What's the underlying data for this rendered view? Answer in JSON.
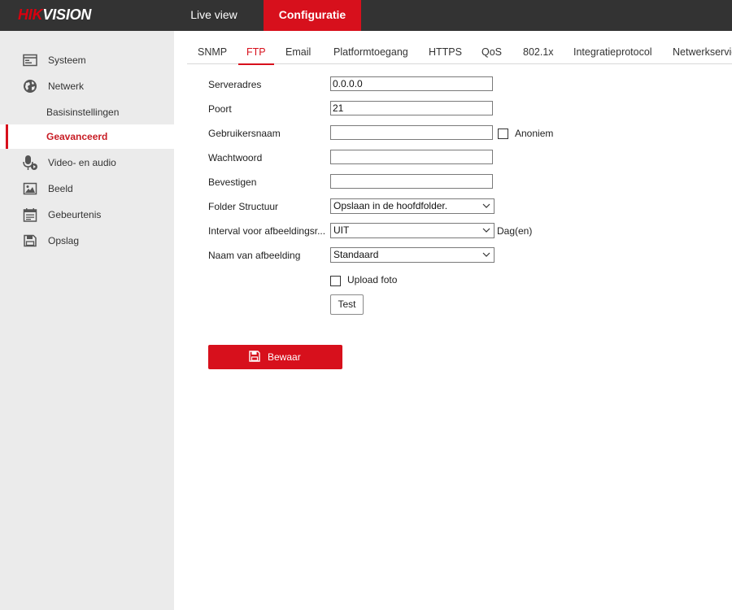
{
  "brand": {
    "name": "HIKVISION",
    "accent_color": "#d7101c",
    "topbar_color": "#333333"
  },
  "topnav": {
    "live_view": "Live view",
    "configuration": "Configuratie"
  },
  "sidebar": {
    "items": [
      {
        "label": "Systeem",
        "icon": "system-icon"
      },
      {
        "label": "Netwerk",
        "icon": "globe-icon"
      },
      {
        "label": "Basisinstellingen"
      },
      {
        "label": "Geavanceerd",
        "active": true
      },
      {
        "label": "Video- en audio",
        "icon": "microphone-icon"
      },
      {
        "label": "Beeld",
        "icon": "image-icon"
      },
      {
        "label": "Gebeurtenis",
        "icon": "calendar-icon"
      },
      {
        "label": "Opslag",
        "icon": "storage-icon"
      }
    ]
  },
  "tabs": [
    {
      "label": "SNMP"
    },
    {
      "label": "FTP",
      "active": true
    },
    {
      "label": "Email"
    },
    {
      "label": "Platformtoegang"
    },
    {
      "label": "HTTPS"
    },
    {
      "label": "QoS"
    },
    {
      "label": "802.1x"
    },
    {
      "label": "Integratieprotocol"
    },
    {
      "label": "Netwerkservice"
    }
  ],
  "form": {
    "server_address": {
      "label": "Serveradres",
      "value": "0.0.0.0"
    },
    "port": {
      "label": "Poort",
      "value": "21"
    },
    "username": {
      "label": "Gebruikersnaam",
      "value": ""
    },
    "anonymous": {
      "label": "Anoniem",
      "checked": false
    },
    "password": {
      "label": "Wachtwoord",
      "value": ""
    },
    "confirm": {
      "label": "Bevestigen",
      "value": ""
    },
    "folder_structure": {
      "label": "Folder Structuur",
      "value": "Opslaan in de hoofdfolder."
    },
    "picture_interval": {
      "label": "Interval voor afbeeldingsr...",
      "value": "UIT",
      "unit": "Dag(en)"
    },
    "picture_name": {
      "label": "Naam van afbeelding",
      "value": "Standaard"
    },
    "upload_photo": {
      "label": "Upload foto",
      "checked": false
    },
    "test_button": "Test",
    "save_button": "Bewaar"
  }
}
